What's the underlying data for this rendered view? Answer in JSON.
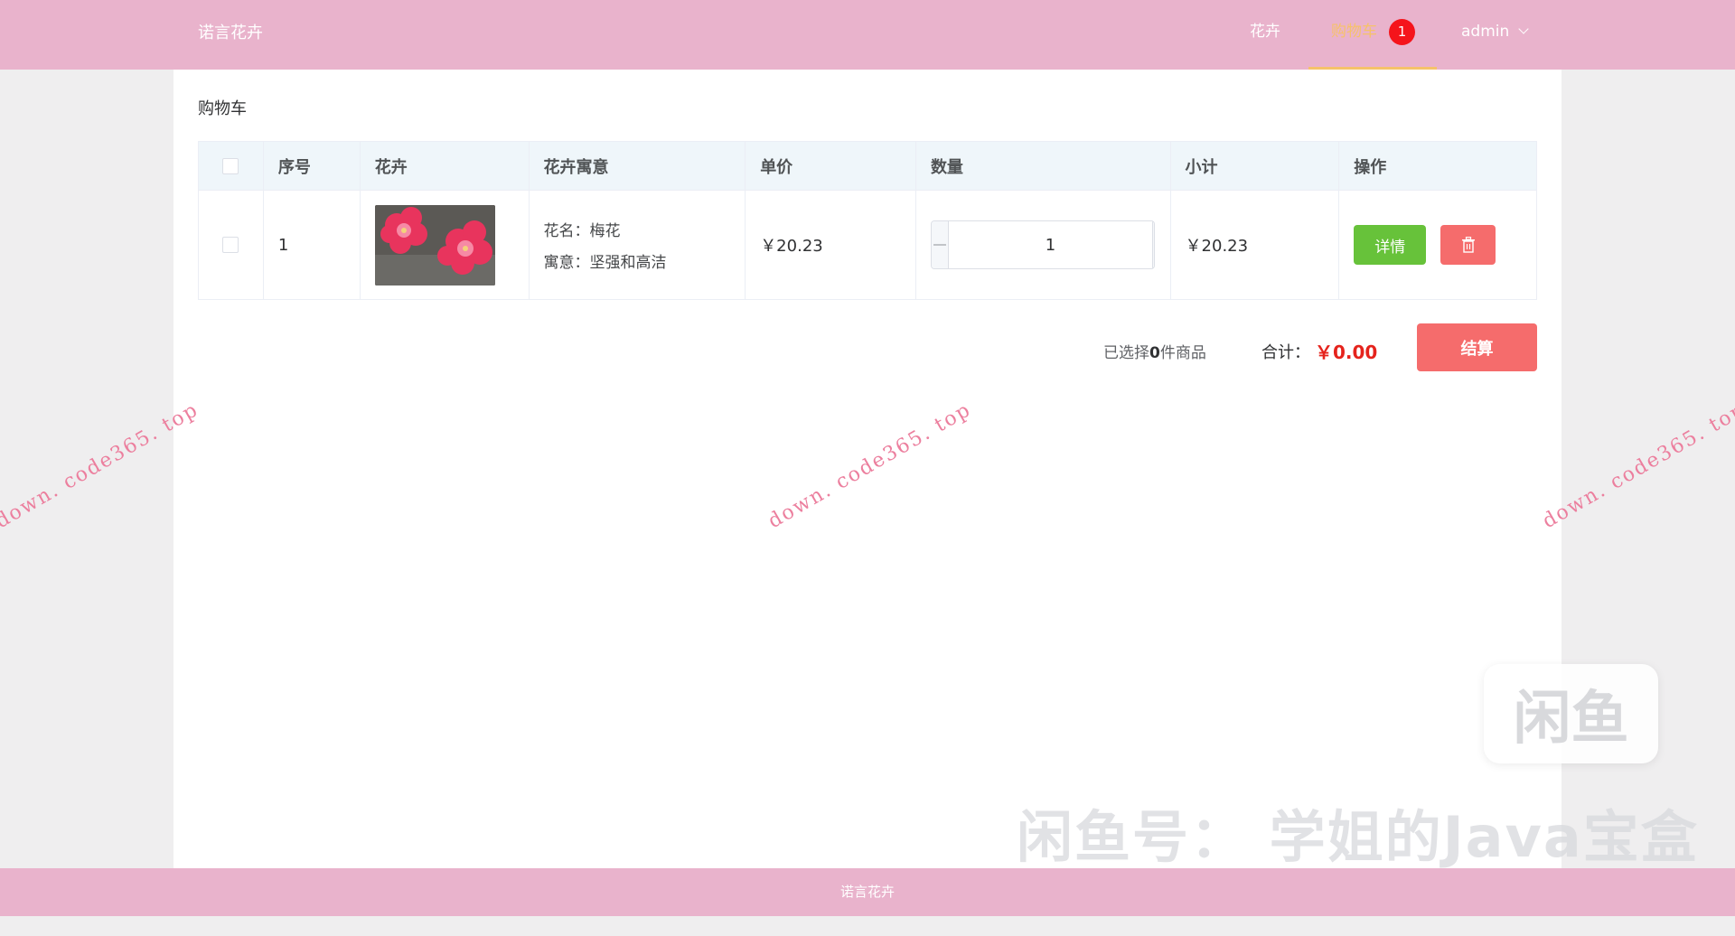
{
  "header": {
    "brand": "诺言花卉",
    "nav": {
      "flowers": "花卉",
      "cart": "购物车",
      "cart_badge": "1",
      "user": "admin"
    }
  },
  "page": {
    "title": "购物车"
  },
  "table": {
    "columns": [
      "序号",
      "花卉",
      "花卉寓意",
      "单价",
      "数量",
      "小计",
      "操作"
    ],
    "rows": [
      {
        "index": "1",
        "name_line": "花名：梅花",
        "meaning_line": "寓意：坚强和高洁",
        "price": "￥20.23",
        "quantity": "1",
        "subtotal": "￥20.23",
        "detail_label": "详情"
      }
    ]
  },
  "summary": {
    "selected_prefix": "已选择",
    "selected_count": "0",
    "selected_suffix": "件商品",
    "total_label": "合计：",
    "total_value": "￥0.00",
    "checkout_label": "结算"
  },
  "footer": {
    "text": "诺言花卉"
  },
  "watermarks": {
    "site": "down. code365. top",
    "xianyu_logo": "闲鱼",
    "xianyu_text": "闲鱼号： 学姐的Java宝盒"
  },
  "colors": {
    "header_bg": "#e9b3cc",
    "active_nav": "#f6c26a",
    "badge": "#f5141b",
    "detail_button": "#67c23a",
    "danger": "#f56c6c",
    "total_price": "#e5231c"
  },
  "icons": {
    "user_menu": "chevron-down-icon",
    "delete": "trash-icon"
  }
}
